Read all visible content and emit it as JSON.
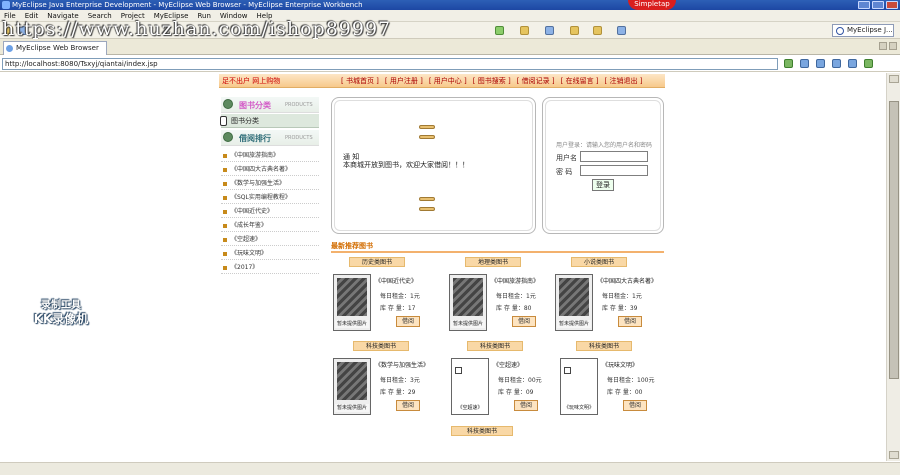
{
  "window": {
    "title": "MyEclipse Java Enterprise Development - MyEclipse Web Browser - MyEclipse Enterprise Workbench",
    "logo": "Simpletap"
  },
  "menu": [
    "File",
    "Edit",
    "Navigate",
    "Search",
    "Project",
    "MyEclipse",
    "Run",
    "Window",
    "Help"
  ],
  "watermark": "https://www.huzhan.com/ishop89997",
  "perspective": "MyEclipse J...",
  "editor_tab": "MyEclipse Web Browser",
  "address": "http://localhost:8080/Tsxyj/qiantai/index.jsp",
  "site": {
    "banner_left": "足不出户 网上购物",
    "nav": [
      "[ 书城首页 ]",
      "[ 用户注册 ]",
      "[ 用户中心 ]",
      "[ 图书搜索 ]",
      "[ 借阅记录 ]",
      "[ 在线留言 ]",
      "[ 注销退出 ]"
    ],
    "categories": {
      "title": "图书分类",
      "subtitle": "PRODUCTS",
      "items": [
        "图书分类"
      ]
    },
    "ranking": {
      "title": "借阅排行",
      "subtitle": "PRODUCTS",
      "items": [
        "《中国旅游指南》",
        "《中国四大古典名著》",
        "《数学与加强生活》",
        "《SQL实用编程教程》",
        "《中国近代史》",
        "《成长年鉴》",
        "《空超速》",
        "《玩味文明》",
        "《2017》"
      ]
    },
    "notice": {
      "line1": "通 知",
      "line2": "本商城开放到图书，欢迎大家借阅！！！"
    },
    "login": {
      "title": "用户登录：请输入您的用户名和密码",
      "user_label": "用户名",
      "pass_label": "密 码",
      "user_value": "",
      "pass_value": "",
      "button": "登录"
    },
    "recommend_title": "最新推荐图书",
    "books": [
      {
        "category": "历史类图书",
        "name": "《中国近代史》",
        "daily_fee": "每日租金：1元",
        "stock": "库 存 量：17",
        "borrow": "借阅",
        "cover": "暂未提供图片"
      },
      {
        "category": "地理类图书",
        "name": "《中国旅游指南》",
        "daily_fee": "每日租金：1元",
        "stock": "库 存 量：80",
        "borrow": "借阅",
        "cover": "暂未提供图片"
      },
      {
        "category": "小说类图书",
        "name": "《中国四大古典名著》",
        "daily_fee": "每日租金：1元",
        "stock": "库 存 量：39",
        "borrow": "借阅",
        "cover": "暂未提供图片"
      },
      {
        "category": "科技类图书",
        "name": "《数学与加强生活》",
        "daily_fee": "每日租金：3元",
        "stock": "库 存 量：29",
        "borrow": "借阅",
        "cover": "暂未提供图片"
      },
      {
        "category": "科技类图书",
        "name": "《空超速》",
        "daily_fee": "每日租金：00元",
        "stock": "库 存 量：09",
        "borrow": "借阅",
        "cover": "《空超速》"
      },
      {
        "category": "科技类图书",
        "name": "《玩味文明》",
        "daily_fee": "每日租金：100元",
        "stock": "库 存 量：00",
        "borrow": "借阅",
        "cover": "《玩味文明》"
      }
    ],
    "bottom_category": "科技类图书"
  },
  "recorder": {
    "line1": "录制工具",
    "line2": "KK录像机"
  }
}
